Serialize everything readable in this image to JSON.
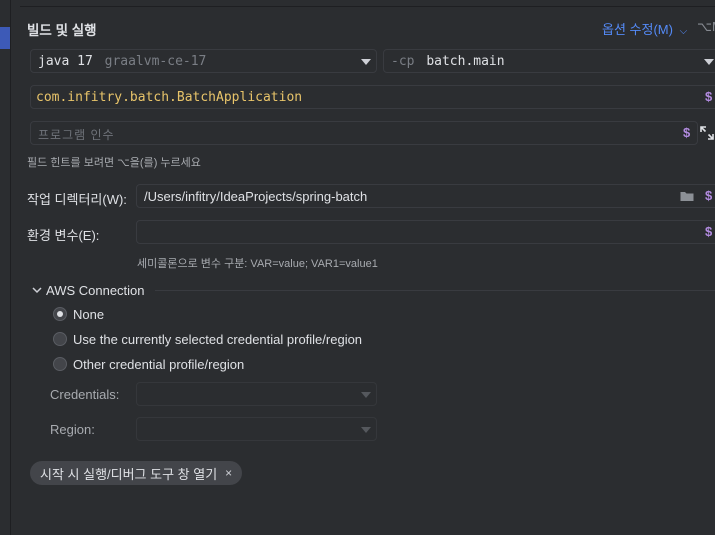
{
  "section": {
    "title": "빌드 및 실행",
    "options_label": "옵션 수정(M)",
    "options_shortcut": "⌥M"
  },
  "run": {
    "jdk_name": "java 17",
    "jdk_detail": "graalvm-ce-17",
    "cp_prefix": "-cp",
    "cp_module": "batch.main",
    "main_class": "com.infitry.batch.BatchApplication",
    "program_args_placeholder": "프로그램 인수",
    "field_hint": "필드 힌트를 보려면 ⌥을(를) 누르세요",
    "macro_symbol": "$"
  },
  "working_dir": {
    "label": "작업 디렉터리(W):",
    "value": "/Users/infitry/IdeaProjects/spring-batch"
  },
  "env": {
    "label": "환경 변수(E):",
    "value": "",
    "hint": "세미콜론으로 변수 구분: VAR=value; VAR1=value1"
  },
  "aws": {
    "title": "AWS Connection",
    "options": [
      {
        "label": "None",
        "selected": true
      },
      {
        "label": "Use the currently selected credential profile/region",
        "selected": false
      },
      {
        "label": "Other credential profile/region",
        "selected": false
      }
    ],
    "credentials_label": "Credentials:",
    "region_label": "Region:"
  },
  "chip": {
    "label": "시작 시 실행/디버그 도구 창 열기",
    "close": "×"
  },
  "colors": {
    "accent": "#548af7",
    "main_class": "#e8c46a",
    "macro": "#b28be0"
  }
}
